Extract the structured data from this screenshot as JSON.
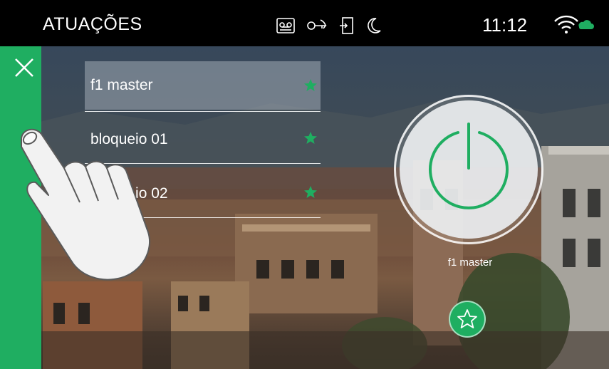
{
  "header": {
    "title": "ATUAÇÕES",
    "time": "11:12",
    "status_icons": [
      "voicemail-icon",
      "key-icon",
      "door-entry-icon",
      "moon-icon"
    ],
    "network_icon": "wifi-cloud-icon"
  },
  "sidebar": {
    "close_icon": "close-icon",
    "accent_color": "#1fae61"
  },
  "actuations": {
    "items": [
      {
        "label": "f1 master",
        "favorite": true,
        "selected": true
      },
      {
        "label": "bloqueio 01",
        "favorite": true,
        "selected": false
      },
      {
        "label": "bloqueio 02",
        "favorite": true,
        "selected": false
      }
    ]
  },
  "control": {
    "caption": "f1 master",
    "power_icon": "power-icon",
    "favorite_icon": "star-outline-icon"
  },
  "overlay": {
    "gesture_icon": "pointing-hand-icon"
  }
}
